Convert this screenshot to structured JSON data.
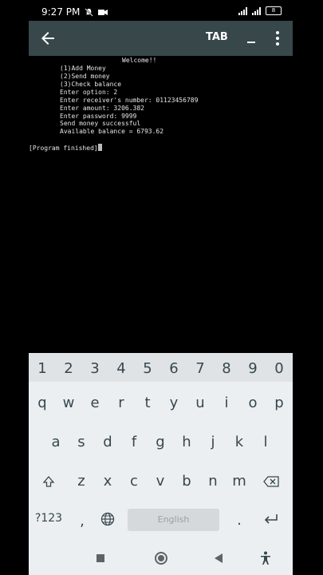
{
  "status": {
    "time": "9:27 PM",
    "battery": "8"
  },
  "toolbar": {
    "tab_label": "TAB"
  },
  "terminal": {
    "lines": [
      "Welcome!!",
      "(1)Add Money",
      "(2)Send money",
      "(3)Check balance",
      "Enter option: 2",
      "Enter receiver's number: 01123456789",
      "Enter amount: 3206.382",
      "Enter password: 9999",
      "Send money successful",
      "Available balance = 6793.62"
    ],
    "finished": "[Program finished]"
  },
  "keyboard": {
    "numbers": [
      "1",
      "2",
      "3",
      "4",
      "5",
      "6",
      "7",
      "8",
      "9",
      "0"
    ],
    "row1": [
      "q",
      "w",
      "e",
      "r",
      "t",
      "y",
      "u",
      "i",
      "o",
      "p"
    ],
    "row2": [
      "a",
      "s",
      "d",
      "f",
      "g",
      "h",
      "j",
      "k",
      "l"
    ],
    "row3": [
      "z",
      "x",
      "c",
      "v",
      "b",
      "n",
      "m"
    ],
    "symbols_label": "?123",
    "comma": ",",
    "period": ".",
    "space_label": "English"
  }
}
